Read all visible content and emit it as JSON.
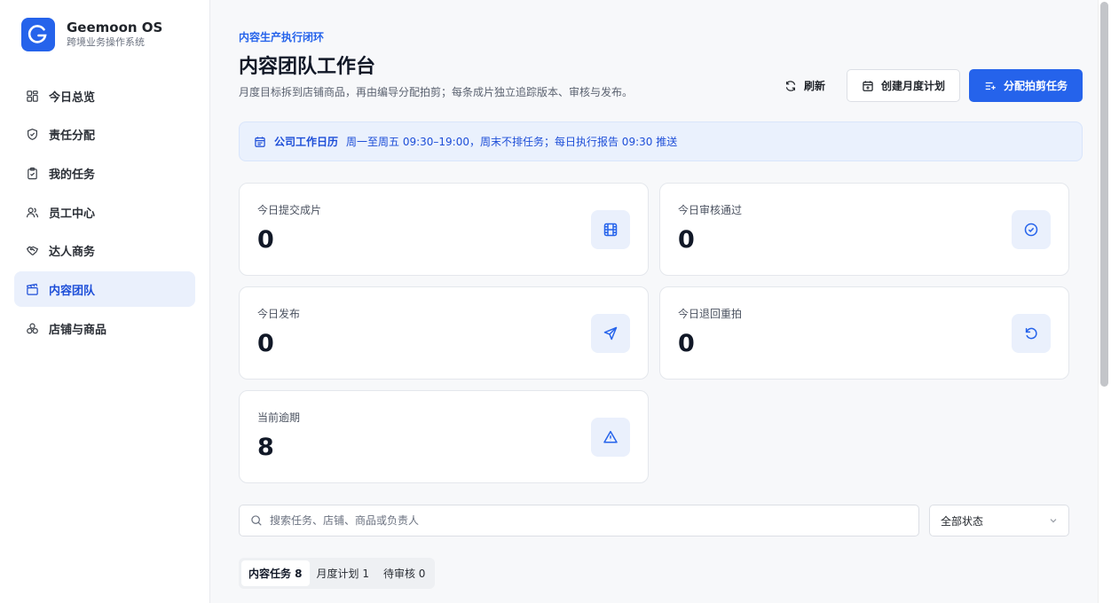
{
  "brand": {
    "name": "Geemoon OS",
    "subtitle": "跨境业务操作系统",
    "logo_letter": "G"
  },
  "sidebar": {
    "items": [
      {
        "label": "今日总览",
        "icon": "dashboard-icon"
      },
      {
        "label": "责任分配",
        "icon": "shield-check-icon"
      },
      {
        "label": "我的任务",
        "icon": "clipboard-check-icon"
      },
      {
        "label": "员工中心",
        "icon": "users-icon"
      },
      {
        "label": "达人商务",
        "icon": "handshake-icon"
      },
      {
        "label": "内容团队",
        "icon": "clapperboard-icon",
        "active": true
      },
      {
        "label": "店铺与商品",
        "icon": "boxes-icon"
      }
    ]
  },
  "header": {
    "eyebrow": "内容生产执行闭环",
    "title": "内容团队工作台",
    "description": "月度目标拆到店铺商品，再由编导分配拍剪；每条成片独立追踪版本、审核与发布。",
    "refresh_label": "刷新",
    "create_plan_label": "创建月度计划",
    "assign_label": "分配拍剪任务"
  },
  "banner": {
    "title": "公司工作日历",
    "text": "周一至周五 09:30–19:00，周末不排任务；每日执行报告 09:30 推送"
  },
  "stats": [
    {
      "label": "今日提交成片",
      "value": "0",
      "icon": "film-icon"
    },
    {
      "label": "今日审核通过",
      "value": "0",
      "icon": "check-circle-icon"
    },
    {
      "label": "今日发布",
      "value": "0",
      "icon": "send-icon"
    },
    {
      "label": "今日退回重拍",
      "value": "0",
      "icon": "rotate-ccw-icon"
    },
    {
      "label": "当前逾期",
      "value": "8",
      "icon": "alert-triangle-icon"
    }
  ],
  "filters": {
    "search_placeholder": "搜索任务、店铺、商品或负责人",
    "status_selected": "全部状态"
  },
  "tabs": [
    {
      "label": "内容任务 8",
      "active": true
    },
    {
      "label": "月度计划 1"
    },
    {
      "label": "待审核 0"
    }
  ],
  "colors": {
    "accent": "#2563eb",
    "accent_soft": "#eaf0fc",
    "banner_bg": "#eaf1fd"
  }
}
